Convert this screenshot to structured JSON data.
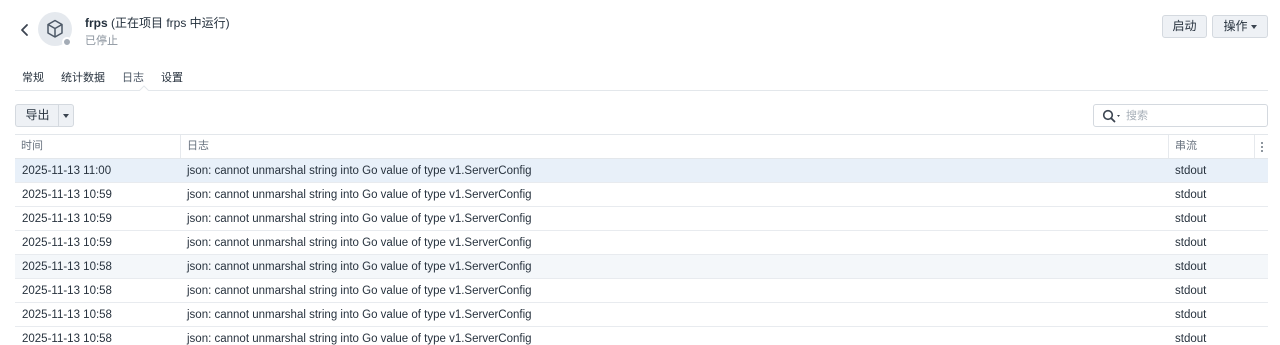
{
  "header": {
    "name": "frps",
    "project_note": "(正在项目 frps 中运行)",
    "status": "已停止",
    "start_label": "启动",
    "actions_label": "操作"
  },
  "tabs": [
    {
      "label": "常规"
    },
    {
      "label": "统计数据"
    },
    {
      "label": "日志",
      "active": true
    },
    {
      "label": "设置"
    }
  ],
  "toolbar": {
    "export_label": "导出",
    "search_placeholder": "搜索"
  },
  "table": {
    "columns": [
      "时间",
      "日志",
      "串流"
    ],
    "rows": [
      {
        "time": "2025-11-13 11:00",
        "log": "json: cannot unmarshal string into Go value of type v1.ServerConfig",
        "stream": "stdout"
      },
      {
        "time": "2025-11-13 10:59",
        "log": "json: cannot unmarshal string into Go value of type v1.ServerConfig",
        "stream": "stdout"
      },
      {
        "time": "2025-11-13 10:59",
        "log": "json: cannot unmarshal string into Go value of type v1.ServerConfig",
        "stream": "stdout"
      },
      {
        "time": "2025-11-13 10:59",
        "log": "json: cannot unmarshal string into Go value of type v1.ServerConfig",
        "stream": "stdout"
      },
      {
        "time": "2025-11-13 10:58",
        "log": "json: cannot unmarshal string into Go value of type v1.ServerConfig",
        "stream": "stdout"
      },
      {
        "time": "2025-11-13 10:58",
        "log": "json: cannot unmarshal string into Go value of type v1.ServerConfig",
        "stream": "stdout"
      },
      {
        "time": "2025-11-13 10:58",
        "log": "json: cannot unmarshal string into Go value of type v1.ServerConfig",
        "stream": "stdout"
      },
      {
        "time": "2025-11-13 10:58",
        "log": "json: cannot unmarshal string into Go value of type v1.ServerConfig",
        "stream": "stdout"
      }
    ]
  },
  "icons": {
    "back": "chevron-left-icon",
    "app": "package-cube-icon",
    "search": "search-icon",
    "column_menu": "more-vertical-icon"
  },
  "colors": {
    "selected_row": "#e8f0f9",
    "button_bg": "#eef1f5",
    "status_stopped": "#a4acb6"
  }
}
